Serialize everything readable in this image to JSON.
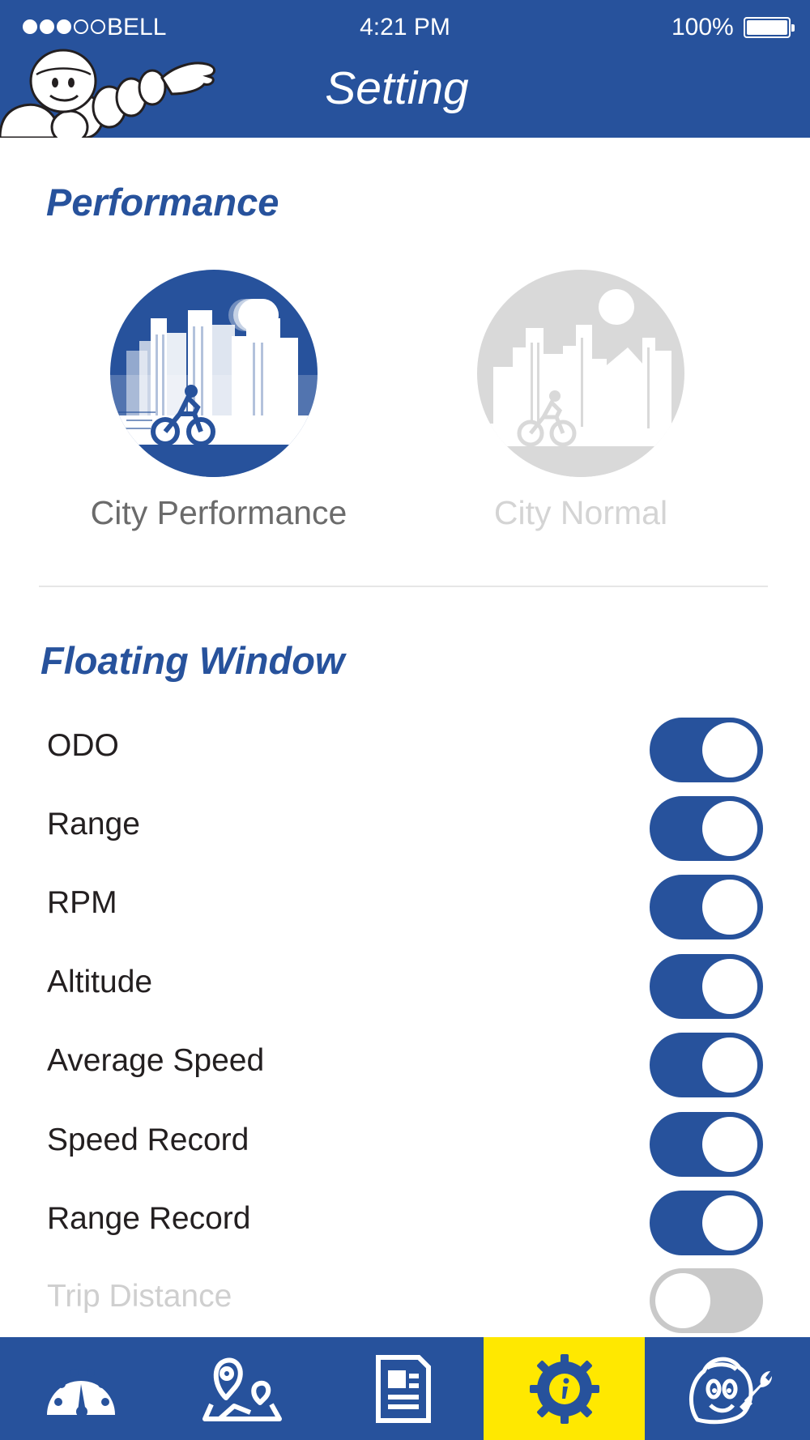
{
  "status_bar": {
    "signal_filled": 3,
    "signal_total": 5,
    "carrier": "BELL",
    "time": "4:21 PM",
    "battery": "100%"
  },
  "header": {
    "title": "Setting"
  },
  "performance": {
    "title": "Performance",
    "modes": [
      {
        "label": "City Performance",
        "selected": true
      },
      {
        "label": "City Normal",
        "selected": false
      }
    ]
  },
  "floating_window": {
    "title": "Floating Window",
    "items": [
      {
        "label": "ODO",
        "on": true
      },
      {
        "label": "Range",
        "on": true
      },
      {
        "label": "RPM",
        "on": true
      },
      {
        "label": "Altitude",
        "on": true
      },
      {
        "label": "Average Speed",
        "on": true
      },
      {
        "label": "Speed Record",
        "on": true
      },
      {
        "label": "Range Record",
        "on": true
      },
      {
        "label": "Trip Distance",
        "on": false
      }
    ]
  },
  "tab_bar": {
    "tabs": [
      {
        "icon": "speedometer-icon",
        "active": false
      },
      {
        "icon": "map-pin-icon",
        "active": false
      },
      {
        "icon": "document-icon",
        "active": false
      },
      {
        "icon": "gear-info-icon",
        "active": true
      },
      {
        "icon": "mascot-wrench-icon",
        "active": false
      }
    ]
  },
  "colors": {
    "brand_blue": "#27529c",
    "active_tab": "#ffe800",
    "inactive_gray": "#d9d9d9",
    "text_dark": "#231f20"
  }
}
